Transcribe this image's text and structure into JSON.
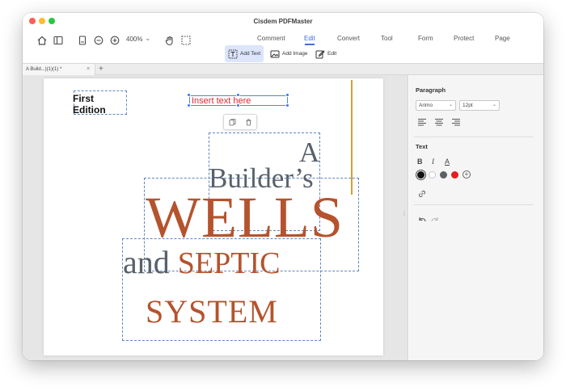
{
  "app": {
    "title": "Cisdem PDFMaster"
  },
  "toolbar": {
    "zoom": "400%",
    "main_tabs": [
      {
        "label": "Comment"
      },
      {
        "label": "Edit"
      },
      {
        "label": "Convert"
      },
      {
        "label": "Tool"
      },
      {
        "label": "Form"
      },
      {
        "label": "Protect"
      },
      {
        "label": "Page"
      }
    ],
    "active_tab": "Edit",
    "edit_tools": [
      {
        "label": "Add Text",
        "icon": "add-text-icon",
        "active": true
      },
      {
        "label": "Add Image",
        "icon": "add-image-icon",
        "active": false
      },
      {
        "label": "Edit",
        "icon": "edit-icon",
        "active": false
      }
    ]
  },
  "document_tab": {
    "label": "A Build...)(1)(1) *"
  },
  "page": {
    "first_edition": "First Edition",
    "insert_text": "Insert text here",
    "title_a": "A",
    "title_builders": "Builder’s",
    "title_wells": "WELLS",
    "title_and": "and",
    "title_septic": "SEPTIC",
    "title_system": "SYSTEM",
    "colors": {
      "rust": "#b5532d",
      "slate": "#58616b",
      "insert_red": "#e0262f",
      "guide": "#d6a02e"
    }
  },
  "panel": {
    "paragraph": {
      "heading": "Paragraph",
      "font": "Arimo",
      "size": "12pt"
    },
    "text": {
      "heading": "Text",
      "bold": "B",
      "italic": "I",
      "underline": "A",
      "swatches": [
        "#111111",
        "#ffffff",
        "#5b6068",
        "#e02020"
      ],
      "selected_swatch": "#111111"
    }
  }
}
